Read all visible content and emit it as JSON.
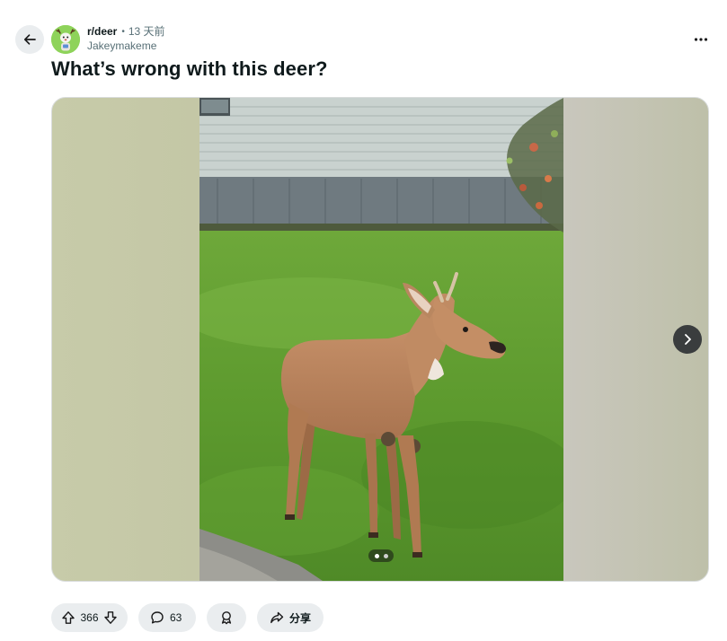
{
  "post": {
    "subreddit": "r/deer",
    "separator": "•",
    "time": "13 天前",
    "author": "Jakeymakeme",
    "title": "What’s wrong with this deer?"
  },
  "gallery": {
    "slide_count": 2,
    "current_slide": 1
  },
  "actions": {
    "upvotes": "366",
    "comments": "63",
    "share_label": "分享"
  },
  "icons": {
    "back": "arrow-left-icon",
    "more": "more-horizontal-icon",
    "next": "chevron-right-icon",
    "upvote": "arrow-up-icon",
    "downvote": "arrow-down-icon",
    "comment": "comment-bubble-icon",
    "award": "award-icon",
    "share": "share-arrow-icon"
  },
  "colors": {
    "pill_bg": "#eaedef",
    "text": "#0f1a1c",
    "muted": "#576f76"
  }
}
